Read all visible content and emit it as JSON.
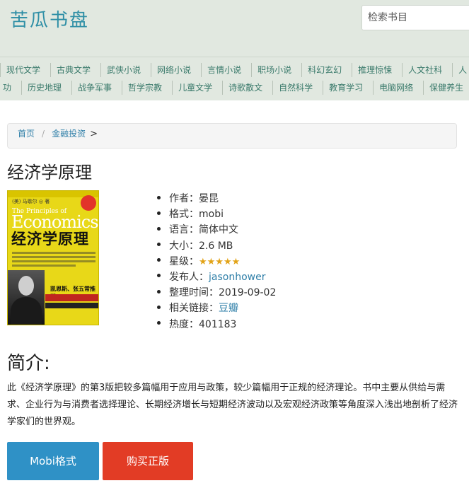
{
  "site": {
    "logo": "苦瓜书盘"
  },
  "search": {
    "placeholder": "检索书目"
  },
  "nav": {
    "row1": [
      "现代文学",
      "古典文学",
      "武侠小说",
      "网络小说",
      "言情小说",
      "职场小说",
      "科幻玄幻",
      "推理惊悚",
      "人文社科",
      "人"
    ],
    "row2": [
      "功",
      "历史地理",
      "战争军事",
      "哲学宗教",
      "儿童文学",
      "诗歌散文",
      "自然科学",
      "教育学习",
      "电脑网络",
      "保健养生"
    ]
  },
  "breadcrumb": {
    "home": "首页",
    "separator": "/",
    "category": "金融投资",
    "arrow": ">"
  },
  "book": {
    "title": "经济学原理",
    "cover": {
      "author_line": "(美) 马歇尔 ◎ 著",
      "english_title_1": "The Principles of",
      "english_title_2": "Economics",
      "chinese_title": "经济学原理",
      "quote": "凯恩斯、张五常推荐"
    },
    "meta": [
      {
        "label": "作者：",
        "value": "晏昆"
      },
      {
        "label": "格式：",
        "value": "mobi"
      },
      {
        "label": "语言：",
        "value": "简体中文"
      },
      {
        "label": "大小：",
        "value": "2.6 MB"
      },
      {
        "label": "星级：",
        "value": "★★★★★",
        "rating": 5,
        "max": 5
      },
      {
        "label": "发布人：",
        "value": "jasonhower",
        "link": true
      },
      {
        "label": "整理时间：",
        "value": "2019-09-02"
      },
      {
        "label": "相关链接：",
        "value": "豆瓣",
        "link": true
      },
      {
        "label": "热度：",
        "value": "401183"
      }
    ]
  },
  "intro": {
    "heading": "简介:",
    "text": "此《经济学原理》的第3版把较多篇幅用于应用与政策，较少篇幅用于正规的经济理论。书中主要从供给与需求、企业行为与消费者选择理论、长期经济增长与短期经济波动以及宏观经济政策等角度深入浅出地剖析了经济学家们的世界观。"
  },
  "buttons": {
    "mobi": "Mobi格式",
    "buy": "购买正版"
  },
  "colors": {
    "accent": "#2f8fa6",
    "header_bg": "#e1e8e0",
    "mobi_button": "#2f91c6",
    "buy_button": "#e23c25",
    "star": "#e2a317"
  }
}
